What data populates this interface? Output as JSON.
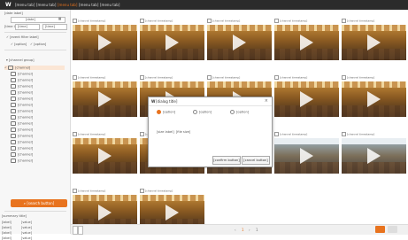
{
  "top_bar": {
    "logo": "W",
    "tabs": [
      {
        "label": "[menu tab]"
      },
      {
        "label": "[menu tab]"
      },
      {
        "label": "[menu tab]"
      },
      {
        "label": "[menu tab]"
      },
      {
        "label": "[menu tab]"
      }
    ],
    "active_tab_index": 2
  },
  "sidebar": {
    "date_label": "[date label]",
    "date_value": "[date]",
    "time_label": "[time label]",
    "time_start": "[time]",
    "time_end": "[time]",
    "event_type_label": "[event filter label]",
    "event_options": [
      {
        "label": "[option]",
        "checked": true
      },
      {
        "label": "[option]",
        "checked": true
      }
    ],
    "channel_group_label": "[channel group]",
    "channels": [
      "[channel]",
      "[channel]",
      "[channel]",
      "[channel]",
      "[channel]",
      "[channel]",
      "[channel]",
      "[channel]",
      "[channel]",
      "[channel]",
      "[channel]",
      "[channel]",
      "[channel]",
      "[channel]",
      "[channel]",
      "[channel]"
    ],
    "selected_channel_index": 0,
    "search_button": "[search button]",
    "summary_title": "[summary title]",
    "summary_rows": [
      {
        "label": "[label]",
        "value": "[value]"
      },
      {
        "label": "[label]",
        "value": "[value]"
      },
      {
        "label": "[label]",
        "value": "[value]"
      },
      {
        "label": "[label]",
        "value": "[value]"
      }
    ]
  },
  "grid": {
    "cells": [
      {
        "caption": "[channel timestamp]",
        "scene": "a"
      },
      {
        "caption": "[channel timestamp]",
        "scene": "a"
      },
      {
        "caption": "[channel timestamp]",
        "scene": "a"
      },
      {
        "caption": "[channel timestamp]",
        "scene": "a"
      },
      {
        "caption": "[channel timestamp]",
        "scene": "a"
      },
      {
        "caption": "[channel timestamp]",
        "scene": "a"
      },
      {
        "caption": "[channel timestamp]",
        "scene": "a"
      },
      {
        "caption": "[channel timestamp]",
        "scene": "a"
      },
      {
        "caption": "[channel timestamp]",
        "scene": "a"
      },
      {
        "caption": "[channel timestamp]",
        "scene": "a"
      },
      {
        "caption": "[channel timestamp]",
        "scene": "a"
      },
      {
        "caption": "[channel timestamp]",
        "scene": "a"
      },
      {
        "caption": "[channel timestamp]",
        "scene": "b"
      },
      {
        "caption": "[channel timestamp]",
        "scene": "b"
      },
      {
        "caption": "[channel timestamp]",
        "scene": "b"
      },
      {
        "caption": "[channel timestamp]",
        "scene": "a"
      },
      {
        "caption": "[channel timestamp]",
        "scene": "a"
      }
    ]
  },
  "pager": {
    "page_current": "1",
    "page_other": "1"
  },
  "modal": {
    "logo": "W",
    "title": "[dialog title]",
    "options": [
      {
        "label": "[option]",
        "selected": true
      },
      {
        "label": "[option]",
        "selected": false
      },
      {
        "label": "[option]",
        "selected": false
      }
    ],
    "info_label": "[size label]",
    "info_value": "[file size]",
    "confirm_button": "[confirm button]",
    "cancel_button": "[cancel button]"
  },
  "colors": {
    "accent": "#e8731e",
    "topbar": "#2b2b2b"
  }
}
